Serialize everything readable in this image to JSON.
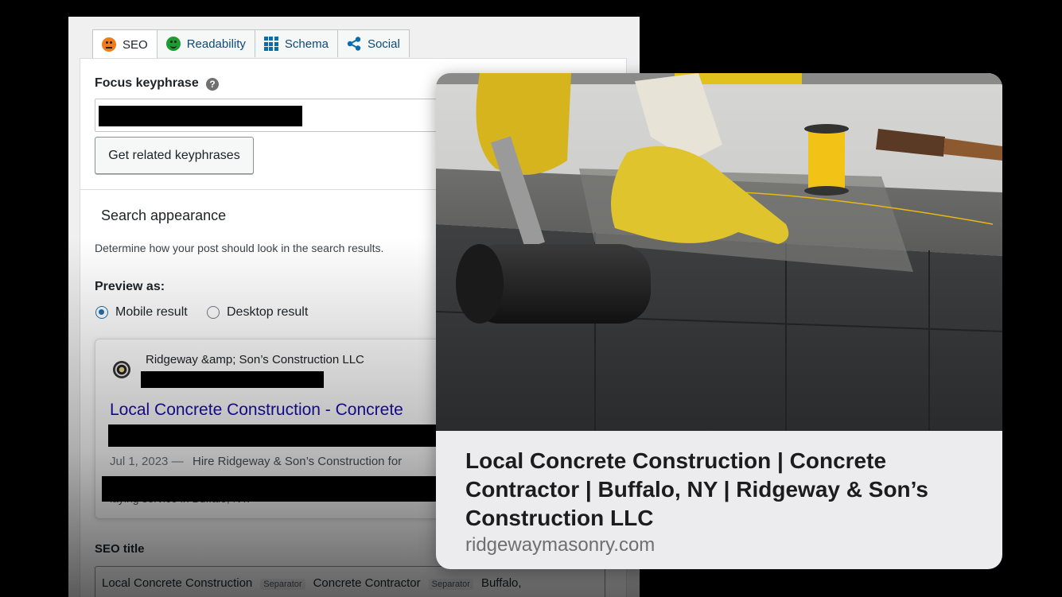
{
  "tabs": [
    {
      "label": "SEO",
      "icon": "orange-face-icon"
    },
    {
      "label": "Readability",
      "icon": "green-face-icon"
    },
    {
      "label": "Schema",
      "icon": "grid-icon"
    },
    {
      "label": "Social",
      "icon": "share-icon"
    }
  ],
  "focus_keyphrase": {
    "label": "Focus keyphrase",
    "help": "?"
  },
  "related_button": "Get related keyphrases",
  "search_appearance": {
    "title": "Search appearance",
    "description": "Determine how your post should look in the search results."
  },
  "preview": {
    "label": "Preview as:",
    "options": [
      "Mobile result",
      "Desktop result"
    ],
    "selected": "Mobile result"
  },
  "serp": {
    "site_name": "Ridgeway &amp; Son’s Construction LLC",
    "title": "Local Concrete Construction - Concrete",
    "date": "Jul 1, 2023",
    "dash": "—",
    "description": "Hire Ridgeway & Son’s Construction for",
    "trailing": "laying service in Buffalo, NY."
  },
  "seo_title": {
    "label": "SEO title",
    "chips": [
      "Local Concrete Construction",
      "Separator",
      "Concrete Contractor",
      "Separator",
      "Buffalo,"
    ]
  },
  "social_card": {
    "title": "Local Concrete Construction | Concrete Contractor | Buffalo, NY | Ridgeway & Son’s Construction LLC",
    "domain": "ridgewaymasonry.com"
  },
  "colors": {
    "link_blue": "#1a0dab",
    "wp_blue": "#2271b1",
    "seo_orange": "#ee7c1b",
    "readability_green": "#1d9a30"
  }
}
